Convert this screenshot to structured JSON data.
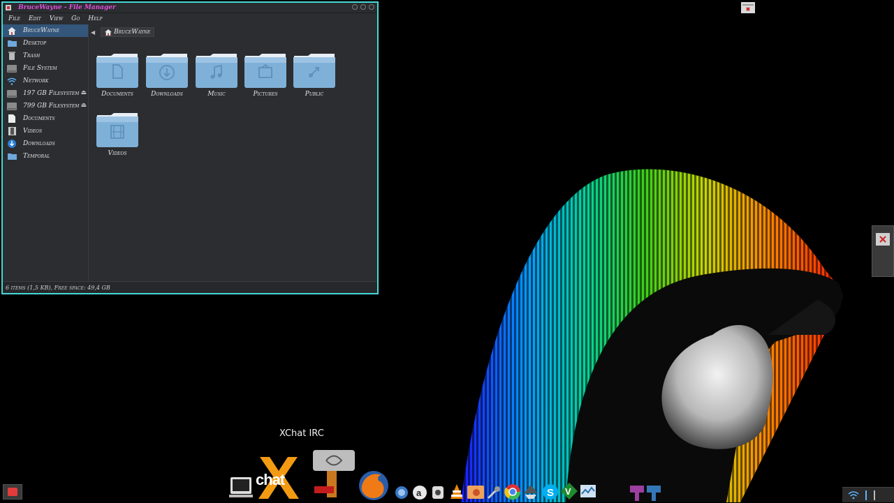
{
  "window": {
    "title": "BruceWayne - File Manager",
    "border_color": "#47d9d6",
    "title_color": "#e04fe0"
  },
  "menubar": [
    "File",
    "Edit",
    "View",
    "Go",
    "Help"
  ],
  "sidebar": {
    "active_color": "#33567a",
    "items": [
      {
        "label": "BruceWayne",
        "icon": "home-icon"
      },
      {
        "label": "Desktop",
        "icon": "folder-icon"
      },
      {
        "label": "Trash",
        "icon": "trash-icon"
      },
      {
        "label": "File System",
        "icon": "drive-icon"
      },
      {
        "label": "Network",
        "icon": "wifi-icon"
      },
      {
        "label": "197 GB Filesystem",
        "icon": "drive-icon",
        "eject": true
      },
      {
        "label": "799 GB Filesystem",
        "icon": "drive-icon",
        "eject": true
      },
      {
        "label": "Documents",
        "icon": "document-icon"
      },
      {
        "label": "Videos",
        "icon": "film-icon"
      },
      {
        "label": "Downloads",
        "icon": "download-icon"
      },
      {
        "label": "Temporal",
        "icon": "folder-icon"
      }
    ]
  },
  "pathbar": {
    "current": "BruceWayne"
  },
  "folders": [
    {
      "label": "Documents",
      "icon": "document-icon"
    },
    {
      "label": "Downloads",
      "icon": "download-icon"
    },
    {
      "label": "Music",
      "icon": "music-icon"
    },
    {
      "label": "Pictures",
      "icon": "picture-icon"
    },
    {
      "label": "Public",
      "icon": "share-icon"
    },
    {
      "label": "Videos",
      "icon": "film-icon"
    }
  ],
  "status": "6 items (1,5 KB), Free space: 49,4 GB",
  "dock": {
    "tooltip": "XChat IRC",
    "xchat_logo_text": "chat"
  }
}
